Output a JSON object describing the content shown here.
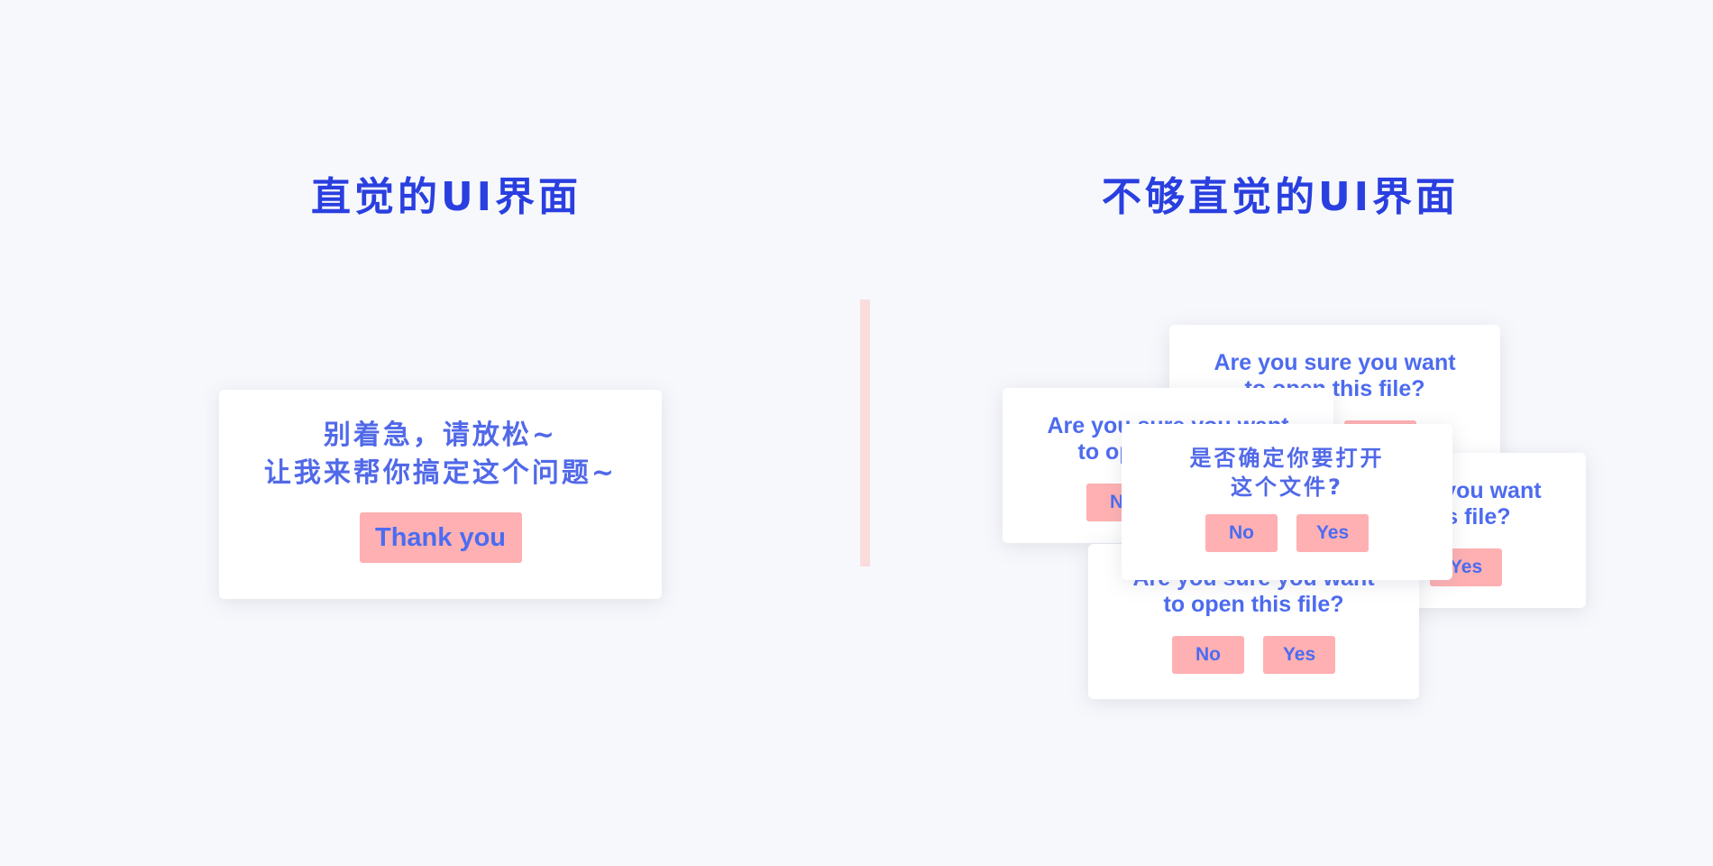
{
  "titles": {
    "left": "直觉的UI界面",
    "right": "不够直觉的UI界面"
  },
  "colors": {
    "background": "#f7f8fc",
    "title": "#2a3fe0",
    "message_text": "#4d6bef",
    "button_bg": "#ffb0b2",
    "divider": "#fadcdd"
  },
  "intuitive_card": {
    "message_line1": "别着急，请放松~",
    "message_line2": "让我来帮你搞定这个问题~",
    "button_label": "Thank you"
  },
  "dialogs": {
    "english": {
      "message_line1": "Are you sure you want",
      "message_line2": "to open this file?",
      "no_label": "No",
      "yes_label": "Yes"
    },
    "chinese": {
      "message_line1": "是否确定你要打开",
      "message_line2": "这个文件?",
      "no_label": "No",
      "yes_label": "Yes"
    }
  }
}
